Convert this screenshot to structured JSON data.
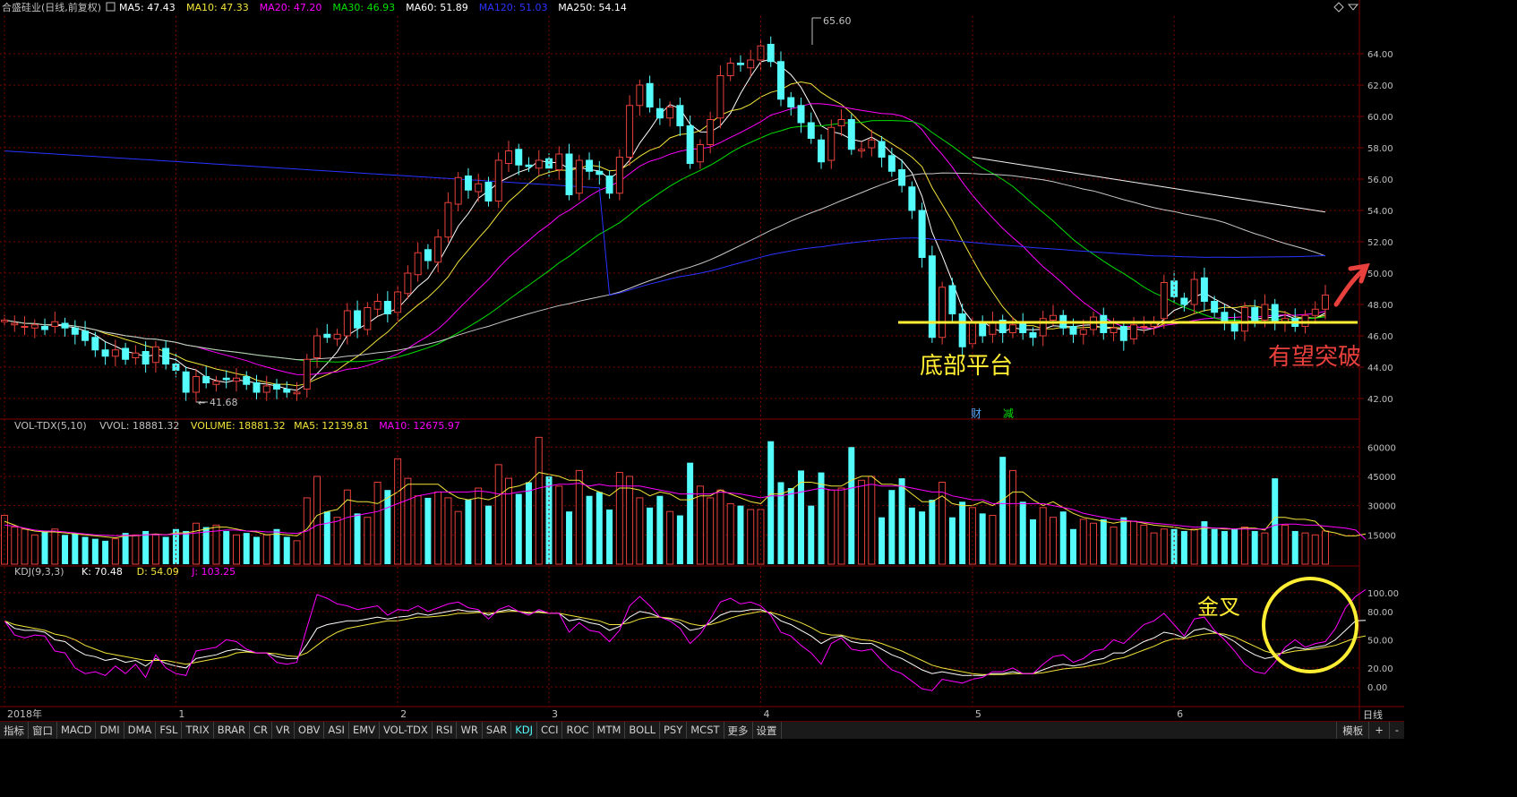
{
  "stock_title": "合盛硅业(日线,前复权)",
  "colors": {
    "up": "#e8403c",
    "down": "#54fcfc",
    "ma5": "#ffffff",
    "ma10": "#f3e43a",
    "ma20": "#ff00ff",
    "ma30": "#00e000",
    "ma60": "#c8c8c8",
    "ma120": "#2a33ff",
    "ma250": "#f0f0f0",
    "grid": "#800000",
    "axis_text": "#c0c0c0",
    "annotation_yellow": "#ffee33",
    "annotation_red": "#e8403c"
  },
  "price_panel": {
    "legend": [
      {
        "label": "MA5: 47.43",
        "color": "#ffffff"
      },
      {
        "label": "MA10: 47.33",
        "color": "#f3e43a"
      },
      {
        "label": "MA20: 47.20",
        "color": "#ff00ff"
      },
      {
        "label": "MA30: 46.93",
        "color": "#00e000"
      },
      {
        "label": "MA60: 51.89",
        "color": "#ffffff"
      },
      {
        "label": "MA120: 51.03",
        "color": "#2a33ff"
      },
      {
        "label": "MA250: 54.14",
        "color": "#ffffff"
      }
    ],
    "y_ticks": [
      "64.00",
      "62.00",
      "60.00",
      "58.00",
      "56.00",
      "54.00",
      "52.00",
      "50.00",
      "48.00",
      "46.00",
      "44.00",
      "42.00"
    ],
    "y_range": [
      40.8,
      66.4
    ],
    "high_label": "65.60",
    "low_label": "41.68",
    "annotation_bottom": "底部平台",
    "annotation_breakout": "有望突破",
    "markers": [
      "财",
      "减"
    ]
  },
  "volume_panel": {
    "legend": [
      {
        "label": "VOL-TDX(5,10)",
        "color": "#c0c0c0"
      },
      {
        "label": "VVOL: 18881.32",
        "color": "#c0c0c0"
      },
      {
        "label": "VOLUME: 18881.32",
        "color": "#f3e43a"
      },
      {
        "label": "MA5: 12139.81",
        "color": "#f3e43a"
      },
      {
        "label": "MA10: 12675.97",
        "color": "#ff00ff"
      }
    ],
    "y_ticks": [
      "60000",
      "45000",
      "30000",
      "15000"
    ],
    "y_range": [
      0,
      67000
    ]
  },
  "kdj_panel": {
    "legend": [
      {
        "label": "KDJ(9,3,3)",
        "color": "#c0c0c0"
      },
      {
        "label": "K: 70.48",
        "color": "#ffffff"
      },
      {
        "label": "D: 54.09",
        "color": "#f3e43a"
      },
      {
        "label": "J: 103.25",
        "color": "#ff00ff"
      }
    ],
    "y_ticks": [
      "100.00",
      "80.00",
      "50.00",
      "20.00",
      "0.00"
    ],
    "y_range": [
      -20,
      115
    ],
    "annotation_golden_cross": "金叉"
  },
  "x_axis": {
    "labels": [
      {
        "text": "2018年",
        "bar": 0
      },
      {
        "text": "1",
        "bar": 17
      },
      {
        "text": "2",
        "bar": 39
      },
      {
        "text": "3",
        "bar": 54
      },
      {
        "text": "4",
        "bar": 75
      },
      {
        "text": "5",
        "bar": 96
      },
      {
        "text": "6",
        "bar": 116
      }
    ],
    "right_label": "日线"
  },
  "toolbar": {
    "tabs": [
      "指标",
      "窗口",
      "MACD",
      "DMI",
      "DMA",
      "FSL",
      "TRIX",
      "BRAR",
      "CR",
      "VR",
      "OBV",
      "ASI",
      "EMV",
      "VOL-TDX",
      "RSI",
      "WR",
      "SAR",
      "KDJ",
      "CCI",
      "ROC",
      "MTM",
      "BOLL",
      "PSY",
      "MCST",
      "更多",
      "设置"
    ],
    "active_tab": "KDJ",
    "right_tabs": [
      "模板",
      "+",
      "-"
    ]
  },
  "chart_data": {
    "type": "candlestick",
    "title": "合盛硅业(日线,前复权)",
    "closes": [
      47.0,
      46.8,
      46.6,
      46.7,
      46.4,
      46.9,
      46.5,
      46.1,
      45.7,
      45.1,
      44.7,
      45.1,
      44.5,
      44.9,
      44.2,
      45.3,
      44.2,
      43.8,
      42.4,
      43.4,
      43.0,
      43.1,
      43.2,
      43.3,
      42.9,
      42.4,
      42.8,
      42.6,
      42.4,
      42.4,
      44.5,
      46.0,
      45.9,
      46.1,
      47.6,
      46.5,
      47.8,
      48.2,
      47.4,
      48.8,
      50.0,
      51.3,
      50.8,
      52.3,
      54.5,
      56.1,
      55.3,
      55.7,
      54.6,
      57.2,
      57.8,
      56.9,
      56.8,
      57.2,
      56.7,
      57.6,
      55.0,
      57.2,
      56.5,
      56.3,
      55.1,
      57.4,
      60.7,
      62.0,
      60.6,
      59.9,
      60.6,
      59.4,
      57.0,
      58.2,
      59.8,
      62.6,
      63.4,
      63.3,
      63.6,
      64.5,
      63.5,
      61.1,
      60.6,
      59.6,
      58.6,
      57.1,
      59.3,
      59.8,
      57.9,
      57.9,
      58.5,
      57.4,
      56.5,
      55.6,
      54.0,
      51.0,
      45.9,
      49.1,
      47.4,
      45.3,
      46.8,
      46.0,
      46.9,
      46.2,
      46.7,
      46.2,
      45.9,
      47.1,
      47.3,
      46.5,
      46.1,
      46.4,
      47.2,
      46.2,
      46.5,
      45.7,
      46.7,
      46.6,
      46.9,
      49.4,
      48.5,
      48.0,
      49.6,
      48.2,
      47.5,
      46.8,
      46.3,
      47.8,
      46.9,
      48.0,
      46.9,
      47.1,
      46.6,
      47.3,
      47.7,
      48.6
    ],
    "opens": [
      46.9,
      46.7,
      46.6,
      46.5,
      46.6,
      46.6,
      46.8,
      46.5,
      46.3,
      45.9,
      45.1,
      44.7,
      45.2,
      44.6,
      45.0,
      44.3,
      45.2,
      44.2,
      43.7,
      42.4,
      43.4,
      42.9,
      43.3,
      43.1,
      43.4,
      43.0,
      42.4,
      42.9,
      42.6,
      42.3,
      42.6,
      44.6,
      46.1,
      45.8,
      46.0,
      47.6,
      46.4,
      47.7,
      48.2,
      47.5,
      48.7,
      49.9,
      51.5,
      50.7,
      52.3,
      54.4,
      56.2,
      55.2,
      55.8,
      54.6,
      57.0,
      57.9,
      56.9,
      56.7,
      57.3,
      56.6,
      57.6,
      55.1,
      57.2,
      56.5,
      56.2,
      55.1,
      57.4,
      60.7,
      62.1,
      60.5,
      59.9,
      60.7,
      59.4,
      57.1,
      58.2,
      59.9,
      62.6,
      63.4,
      63.1,
      63.6,
      64.6,
      63.5,
      61.2,
      60.7,
      59.6,
      58.5,
      57.2,
      59.4,
      59.8,
      57.8,
      58.0,
      58.4,
      57.5,
      56.6,
      55.5,
      54.0,
      51.1,
      45.9,
      49.2,
      47.4,
      45.5,
      46.8,
      46.1,
      47.0,
      46.2,
      46.8,
      46.2,
      46.0,
      47.0,
      47.3,
      46.6,
      46.1,
      46.4,
      47.3,
      46.2,
      46.6,
      45.8,
      46.6,
      46.6,
      47.1,
      49.5,
      48.4,
      48.0,
      49.7,
      48.2,
      47.5,
      46.8,
      46.3,
      47.8,
      47.0,
      48.0,
      46.9,
      47.1,
      46.6,
      47.3,
      47.7
    ],
    "volumes": [
      25000,
      19000,
      18000,
      15000,
      17000,
      18000,
      15000,
      16000,
      14000,
      13000,
      12000,
      13000,
      16000,
      15000,
      17000,
      15000,
      14000,
      18000,
      17000,
      21000,
      19000,
      20000,
      17000,
      15000,
      16000,
      14000,
      15000,
      18000,
      14000,
      12000,
      34000,
      45000,
      27000,
      24000,
      38000,
      26000,
      24000,
      42000,
      38000,
      54000,
      44000,
      35000,
      34000,
      37000,
      34000,
      27000,
      33000,
      39000,
      30000,
      51000,
      44000,
      36000,
      42000,
      65000,
      45000,
      40000,
      27000,
      48000,
      35000,
      37000,
      28000,
      47000,
      45000,
      34000,
      29000,
      35000,
      27000,
      25000,
      52000,
      40000,
      34000,
      38000,
      31000,
      30000,
      28000,
      28000,
      63000,
      42000,
      39000,
      48000,
      30000,
      47000,
      38000,
      39000,
      60000,
      43000,
      45000,
      24000,
      38000,
      44000,
      29000,
      27000,
      33000,
      42000,
      24000,
      32000,
      29000,
      26000,
      25000,
      55000,
      48000,
      32000,
      23000,
      29000,
      24000,
      27000,
      18000,
      23000,
      21000,
      23000,
      19000,
      24000,
      22000,
      20000,
      16000,
      18000,
      18000,
      17000,
      18000,
      22000,
      18000,
      17000,
      18000,
      19000,
      17000,
      16000,
      44000,
      20000,
      17000,
      16000,
      15000,
      17000,
      13000,
      12000,
      17000,
      18881
    ],
    "vol_ma5": [
      22000,
      20000,
      18000,
      17000,
      16500,
      16500,
      16000,
      15500,
      15000,
      14500,
      14000,
      13500,
      14500,
      14500,
      15000,
      15500,
      15000,
      16000,
      16000,
      17000,
      18000,
      19000,
      19000,
      18000,
      17000,
      16500,
      15000,
      15500,
      15000,
      14500,
      18000,
      25000,
      27000,
      28000,
      33000,
      32000,
      32000,
      31000,
      34000,
      37000,
      41000,
      41000,
      41000,
      41000,
      37000,
      34000,
      33000,
      34000,
      33000,
      35000,
      39000,
      40000,
      42000,
      47000,
      46000,
      45000,
      43000,
      43000,
      39000,
      37000,
      35000,
      39000,
      39000,
      38000,
      35000,
      37000,
      36000,
      33000,
      33000,
      35000,
      35000,
      38000,
      36000,
      34000,
      32000,
      31000,
      36000,
      36000,
      38000,
      42000,
      42000,
      41000,
      40000,
      40000,
      43000,
      45000,
      45000,
      41000,
      41000,
      40000,
      36000,
      32000,
      32000,
      35000,
      31000,
      30000,
      30000,
      32000,
      30000,
      33000,
      37000,
      37000,
      33000,
      30000,
      32000,
      29000,
      26000,
      24000,
      23000,
      22000,
      21000,
      22000,
      22000,
      21000,
      20000,
      19500,
      19000,
      18000,
      17500,
      18500,
      18500,
      18000,
      18000,
      18500,
      18500,
      17500,
      24000,
      24000,
      23000,
      23000,
      22000,
      17000,
      16000,
      14500,
      14500,
      15500
    ],
    "vol_ma10": [
      20000,
      19500,
      18500,
      17500,
      17000,
      17000,
      16500,
      16000,
      15500,
      15000,
      14800,
      14600,
      14800,
      14700,
      15000,
      15200,
      15000,
      15500,
      15500,
      16000,
      16500,
      17000,
      17500,
      17500,
      17000,
      17000,
      16500,
      16500,
      16000,
      15800,
      17000,
      20000,
      21000,
      22000,
      24000,
      25000,
      26000,
      27000,
      29000,
      31000,
      33000,
      35000,
      36000,
      37000,
      37000,
      37000,
      37000,
      37500,
      37000,
      36000,
      36000,
      37000,
      37500,
      39000,
      40000,
      41000,
      41000,
      41500,
      40000,
      41000,
      40000,
      40000,
      40000,
      40000,
      39000,
      38000,
      37000,
      36000,
      36000,
      36000,
      36000,
      37000,
      36500,
      36000,
      35000,
      34000,
      35000,
      35000,
      36000,
      37000,
      38000,
      39000,
      38000,
      38000,
      39000,
      40000,
      41000,
      40000,
      40000,
      40000,
      39000,
      38000,
      37000,
      37000,
      35000,
      34000,
      33000,
      33000,
      31000,
      31000,
      31000,
      31000,
      31000,
      31000,
      30000,
      29000,
      28000,
      26000,
      25000,
      24000,
      23000,
      22500,
      22000,
      21500,
      21000,
      20500,
      20000,
      19500,
      19000,
      19000,
      18500,
      18500,
      18000,
      18000,
      18000,
      18000,
      20000,
      20500,
      20500,
      20000,
      20000,
      19500,
      19000,
      18500,
      17500,
      12676
    ],
    "kdj_k": [
      70,
      62,
      60,
      60,
      58,
      50,
      48,
      40,
      34,
      32,
      28,
      30,
      26,
      28,
      22,
      30,
      25,
      22,
      20,
      30,
      32,
      34,
      38,
      40,
      38,
      36,
      36,
      32,
      30,
      30,
      45,
      62,
      66,
      68,
      70,
      70,
      72,
      74,
      72,
      74,
      75,
      78,
      76,
      78,
      80,
      82,
      80,
      80,
      76,
      80,
      82,
      80,
      78,
      80,
      78,
      78,
      70,
      72,
      68,
      66,
      60,
      64,
      74,
      80,
      78,
      74,
      72,
      68,
      60,
      62,
      68,
      76,
      80,
      80,
      82,
      82,
      78,
      70,
      66,
      60,
      54,
      46,
      52,
      54,
      48,
      46,
      46,
      40,
      34,
      30,
      24,
      18,
      14,
      16,
      14,
      12,
      12,
      12,
      14,
      14,
      16,
      14,
      14,
      18,
      22,
      24,
      22,
      24,
      28,
      30,
      36,
      36,
      42,
      48,
      52,
      58,
      56,
      52,
      60,
      62,
      58,
      54,
      48,
      40,
      34,
      30,
      32,
      38,
      42,
      40,
      42,
      44,
      50,
      60,
      70,
      70.48
    ],
    "kdj_d": [
      70,
      66,
      64,
      62,
      60,
      56,
      54,
      50,
      44,
      40,
      36,
      34,
      32,
      30,
      28,
      28,
      28,
      26,
      24,
      26,
      28,
      30,
      32,
      36,
      37,
      36,
      36,
      35,
      33,
      32,
      36,
      44,
      52,
      58,
      62,
      64,
      66,
      68,
      70,
      70,
      72,
      74,
      74,
      75,
      76,
      78,
      78,
      79,
      78,
      79,
      80,
      80,
      79,
      79,
      78,
      78,
      76,
      74,
      72,
      70,
      66,
      66,
      68,
      72,
      74,
      74,
      73,
      71,
      67,
      65,
      66,
      69,
      73,
      76,
      78,
      80,
      79,
      76,
      72,
      68,
      63,
      57,
      55,
      55,
      52,
      50,
      49,
      46,
      42,
      38,
      33,
      28,
      23,
      20,
      18,
      16,
      14,
      13,
      13,
      13,
      14,
      14,
      14,
      15,
      17,
      19,
      20,
      21,
      23,
      25,
      29,
      31,
      35,
      39,
      43,
      48,
      51,
      51,
      54,
      56,
      57,
      56,
      53,
      48,
      43,
      38,
      35,
      36,
      38,
      39,
      40,
      42,
      44,
      48,
      52,
      54.09
    ],
    "kdj_j": [
      70,
      55,
      52,
      55,
      54,
      38,
      36,
      20,
      14,
      16,
      12,
      22,
      14,
      24,
      10,
      34,
      20,
      14,
      12,
      38,
      40,
      42,
      50,
      48,
      40,
      36,
      36,
      26,
      24,
      26,
      63,
      98,
      94,
      88,
      86,
      82,
      84,
      86,
      76,
      82,
      81,
      86,
      80,
      84,
      88,
      90,
      84,
      82,
      72,
      82,
      86,
      80,
      76,
      82,
      78,
      78,
      58,
      68,
      60,
      58,
      48,
      60,
      86,
      96,
      86,
      74,
      70,
      62,
      46,
      56,
      72,
      90,
      94,
      88,
      90,
      86,
      76,
      58,
      54,
      44,
      36,
      24,
      46,
      52,
      40,
      38,
      40,
      28,
      18,
      14,
      6,
      -2,
      -4,
      8,
      6,
      4,
      8,
      10,
      16,
      16,
      20,
      14,
      14,
      24,
      32,
      34,
      26,
      30,
      38,
      40,
      50,
      46,
      56,
      66,
      70,
      78,
      66,
      54,
      72,
      74,
      60,
      50,
      38,
      24,
      16,
      14,
      26,
      42,
      50,
      42,
      46,
      48,
      62,
      84,
      96,
      103.25
    ]
  }
}
